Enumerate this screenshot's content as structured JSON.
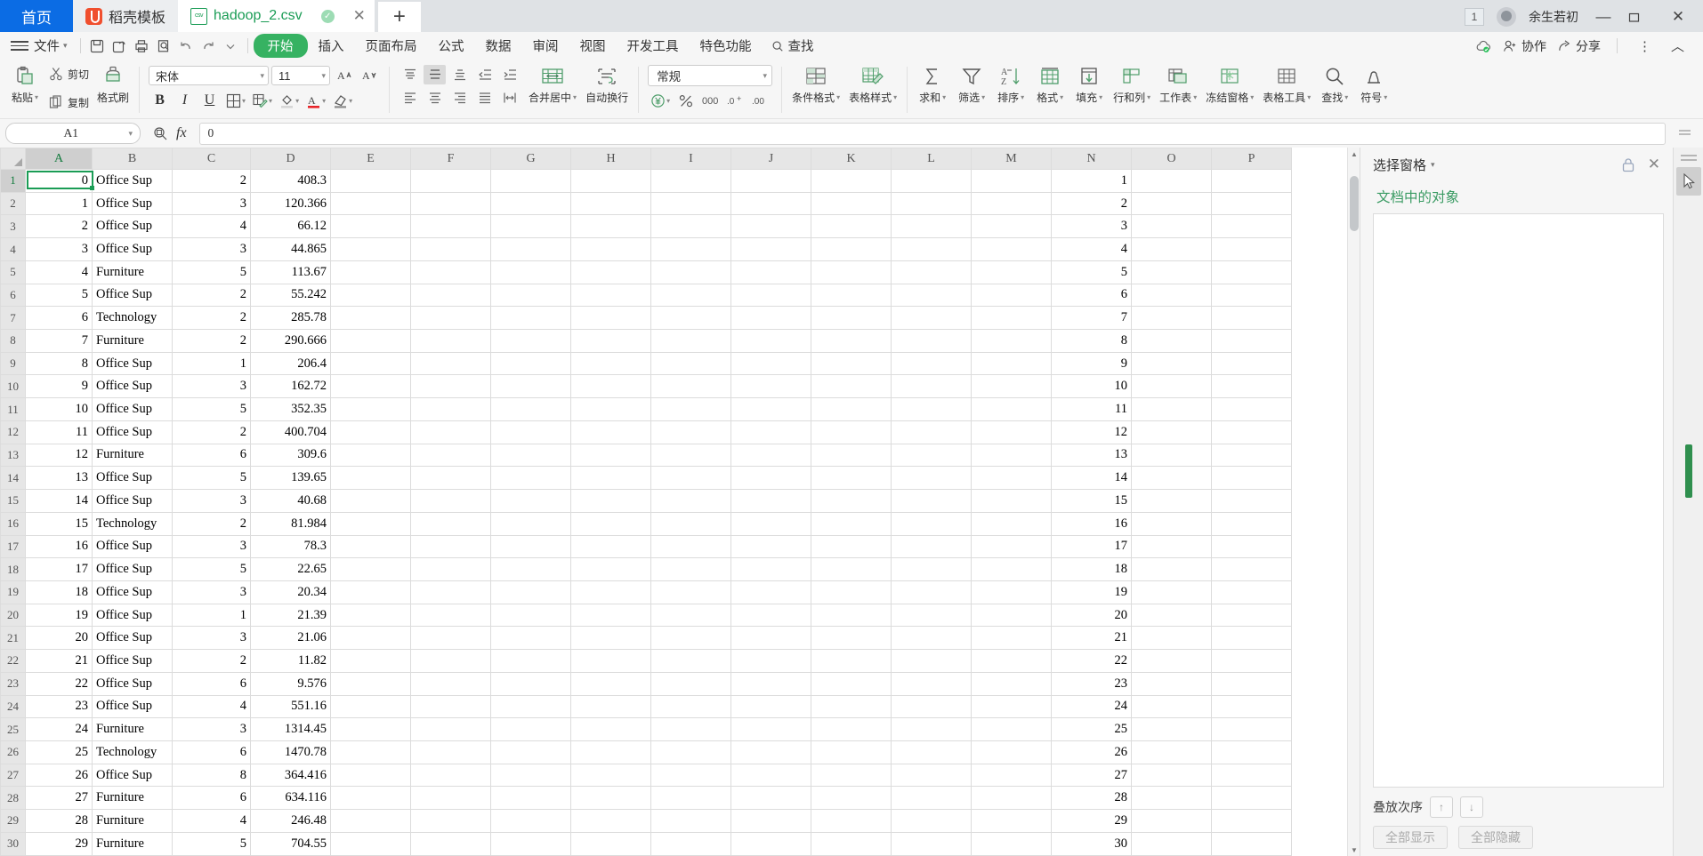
{
  "tabbar": {
    "home_tab": "首页",
    "template_tab": "稻壳模板",
    "file_tab": "hadoop_2.csv",
    "csv_icon_label": "csv",
    "check_icon": "✓",
    "close_icon": "✕",
    "new_tab_icon": "+",
    "badge_count": "1",
    "username": "余生若初",
    "minimize_icon": "—",
    "maximize_icon": "▭",
    "window_close_icon": "✕"
  },
  "menubar": {
    "file_label": "文件",
    "quick_icons": [
      "save-icon",
      "undo-arrow-icon",
      "print-icon",
      "print-preview-icon",
      "undo-icon",
      "redo-icon",
      "customize-icon"
    ],
    "tabs": [
      "开始",
      "插入",
      "页面布局",
      "公式",
      "数据",
      "审阅",
      "视图",
      "开发工具",
      "特色功能"
    ],
    "selected_tab": "开始",
    "search_label": "查找",
    "cloud_icon": "cloud-sync-icon",
    "collab_label": "协作",
    "share_label": "分享",
    "more_icon": "⋮",
    "collapse_icon": "︿"
  },
  "ribbon": {
    "clipboard": {
      "paste": "粘贴",
      "cut": "剪切",
      "copy": "复制",
      "format_painter": "格式刷"
    },
    "font": {
      "family": "宋体",
      "size": "11",
      "grow_icon": "A↑",
      "shrink_icon": "A↓",
      "bold": "B",
      "italic": "I",
      "underline": "U",
      "borders_icon": "borders-icon",
      "cell_style_icon": "cell-style-icon",
      "fill_color_icon": "fill-color-icon",
      "font_color_icon": "font-color-icon",
      "clear_format_icon": "clear-format-icon"
    },
    "alignment": {
      "merge_center": "合并居中",
      "wrap_text": "自动换行"
    },
    "number": {
      "format": "常规",
      "currency_icon": "currency-icon",
      "percent_icon": "%",
      "comma_icon": "000",
      "inc_decimal_icon": ".0+",
      "dec_decimal_icon": ".00"
    },
    "styles": {
      "conditional_format": "条件格式",
      "table_style": "表格样式"
    },
    "editing": {
      "sum": "求和",
      "filter": "筛选",
      "sort": "排序",
      "format": "格式",
      "fill": "填充",
      "rows_cols": "行和列",
      "worksheet": "工作表",
      "freeze_panes": "冻结窗格",
      "table_tools": "表格工具",
      "find": "查找",
      "symbol": "符号"
    }
  },
  "formulabar": {
    "name_box": "A1",
    "fx_label": "fx",
    "zoom_icon": "zoom-icon",
    "formula_value": "0"
  },
  "grid": {
    "columns": [
      "A",
      "B",
      "C",
      "D",
      "E",
      "F",
      "G",
      "H",
      "I",
      "J",
      "K",
      "L",
      "M",
      "N",
      "O",
      "P"
    ],
    "selected_column": "A",
    "selected_row": "1",
    "selected_cell": "A1",
    "rows": [
      {
        "n": "1",
        "a": "0",
        "b": "Office Sup",
        "c": "2",
        "d": "408.3"
      },
      {
        "n": "2",
        "a": "1",
        "b": "Office Sup",
        "c": "3",
        "d": "120.366"
      },
      {
        "n": "3",
        "a": "2",
        "b": "Office Sup",
        "c": "4",
        "d": "66.12"
      },
      {
        "n": "4",
        "a": "3",
        "b": "Office Sup",
        "c": "3",
        "d": "44.865"
      },
      {
        "n": "5",
        "a": "4",
        "b": "Furniture",
        "c": "5",
        "d": "113.67"
      },
      {
        "n": "6",
        "a": "5",
        "b": "Office Sup",
        "c": "2",
        "d": "55.242"
      },
      {
        "n": "7",
        "a": "6",
        "b": "Technology",
        "c": "2",
        "d": "285.78"
      },
      {
        "n": "8",
        "a": "7",
        "b": "Furniture",
        "c": "2",
        "d": "290.666"
      },
      {
        "n": "9",
        "a": "8",
        "b": "Office Sup",
        "c": "1",
        "d": "206.4"
      },
      {
        "n": "10",
        "a": "9",
        "b": "Office Sup",
        "c": "3",
        "d": "162.72"
      },
      {
        "n": "11",
        "a": "10",
        "b": "Office Sup",
        "c": "5",
        "d": "352.35"
      },
      {
        "n": "12",
        "a": "11",
        "b": "Office Sup",
        "c": "2",
        "d": "400.704"
      },
      {
        "n": "13",
        "a": "12",
        "b": "Furniture",
        "c": "6",
        "d": "309.6"
      },
      {
        "n": "14",
        "a": "13",
        "b": "Office Sup",
        "c": "5",
        "d": "139.65"
      },
      {
        "n": "15",
        "a": "14",
        "b": "Office Sup",
        "c": "3",
        "d": "40.68"
      },
      {
        "n": "16",
        "a": "15",
        "b": "Technology",
        "c": "2",
        "d": "81.984"
      },
      {
        "n": "17",
        "a": "16",
        "b": "Office Sup",
        "c": "3",
        "d": "78.3"
      },
      {
        "n": "18",
        "a": "17",
        "b": "Office Sup",
        "c": "5",
        "d": "22.65"
      },
      {
        "n": "19",
        "a": "18",
        "b": "Office Sup",
        "c": "3",
        "d": "20.34"
      },
      {
        "n": "20",
        "a": "19",
        "b": "Office Sup",
        "c": "1",
        "d": "21.39"
      },
      {
        "n": "21",
        "a": "20",
        "b": "Office Sup",
        "c": "3",
        "d": "21.06"
      },
      {
        "n": "22",
        "a": "21",
        "b": "Office Sup",
        "c": "2",
        "d": "11.82"
      },
      {
        "n": "23",
        "a": "22",
        "b": "Office Sup",
        "c": "6",
        "d": "9.576"
      },
      {
        "n": "24",
        "a": "23",
        "b": "Office Sup",
        "c": "4",
        "d": "551.16"
      },
      {
        "n": "25",
        "a": "24",
        "b": "Furniture",
        "c": "3",
        "d": "1314.45"
      },
      {
        "n": "26",
        "a": "25",
        "b": "Technology",
        "c": "6",
        "d": "1470.78"
      },
      {
        "n": "27",
        "a": "26",
        "b": "Office Sup",
        "c": "8",
        "d": "364.416"
      },
      {
        "n": "28",
        "a": "27",
        "b": "Furniture",
        "c": "6",
        "d": "634.116"
      },
      {
        "n": "29",
        "a": "28",
        "b": "Furniture",
        "c": "4",
        "d": "246.48"
      },
      {
        "n": "30",
        "a": "29",
        "b": "Furniture",
        "c": "5",
        "d": "704.55"
      }
    ]
  },
  "rightpanel": {
    "title": "选择窗格",
    "lock_icon": "lock-icon",
    "close_icon": "✕",
    "subtitle": "文档中的对象",
    "order_label": "叠放次序",
    "up_icon": "↑",
    "down_icon": "↓",
    "show_all": "全部显示",
    "hide_all": "全部隐藏"
  },
  "colors": {
    "accent_green": "#36b262",
    "tab_blue": "#0b6ce4",
    "docer_orange": "#f04f2e",
    "selection_green": "#1a9c55",
    "panel_bg": "#f6f6f6"
  }
}
